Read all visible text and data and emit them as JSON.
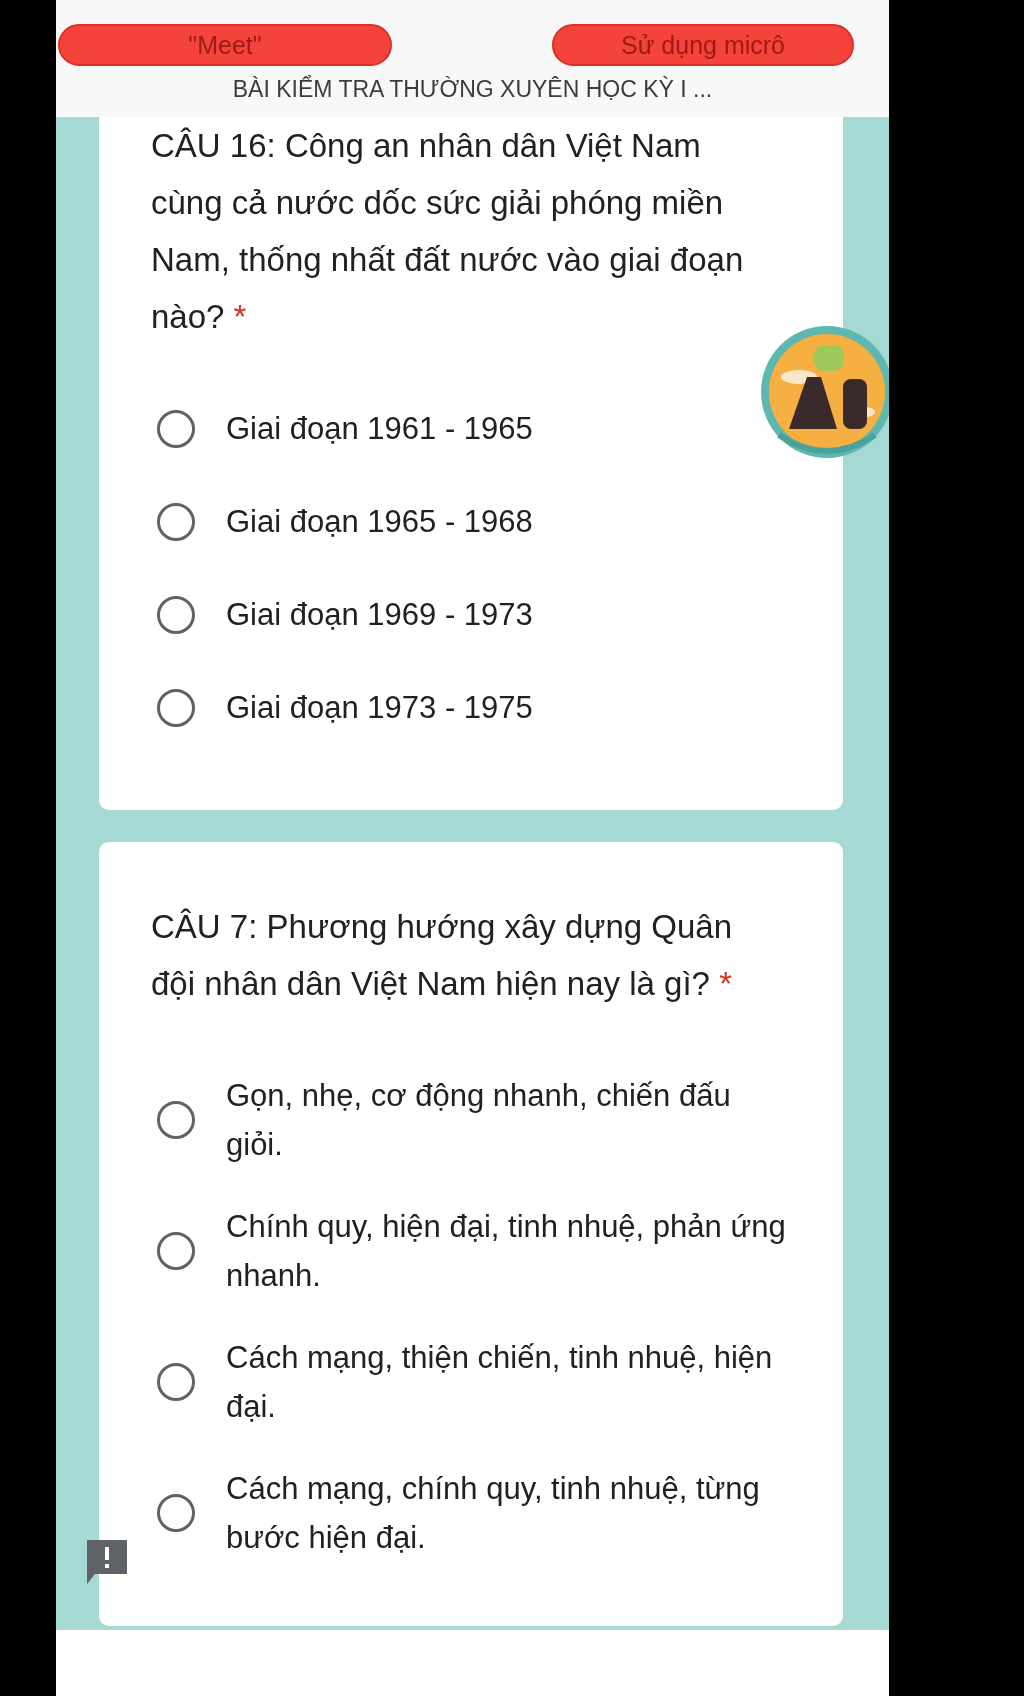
{
  "header": {
    "buttons": [
      "\"Meet\"",
      "Sử dụng micrô"
    ],
    "title": "BÀI KIỂM TRA THƯỜNG XUYÊN HỌC KỲ I ..."
  },
  "questions": [
    {
      "text": "CÂU 16: Công an nhân dân Việt Nam cùng cả nước dốc sức giải phóng miền Nam, thống nhất đất nước vào giai đoạn nào?",
      "required_mark": "*",
      "options": [
        {
          "label": "Giai đoạn 1961 - 1965",
          "selected": false
        },
        {
          "label": "Giai đoạn 1965 - 1968",
          "selected": false
        },
        {
          "label": "Giai đoạn 1969 - 1973",
          "selected": false
        },
        {
          "label": "Giai đoạn 1973 - 1975",
          "selected": false
        }
      ]
    },
    {
      "text": "CÂU 7: Phương hướng xây dựng Quân đội nhân dân Việt Nam hiện nay là gì?",
      "required_mark": "*",
      "feedback_icon": true,
      "options": [
        {
          "label": "Gọn, nhẹ, cơ động nhanh, chiến đấu giỏi.",
          "selected": false
        },
        {
          "label": "Chính quy, hiện đại, tinh nhuệ, phản ứng nhanh.",
          "selected": false
        },
        {
          "label": "Cách mạng, thiện chiến, tinh nhuệ, hiện đại.",
          "selected": false
        },
        {
          "label": "Cách mạng, chính quy, tinh nhuệ, từng bước hiện đại.",
          "selected": false
        }
      ]
    }
  ]
}
